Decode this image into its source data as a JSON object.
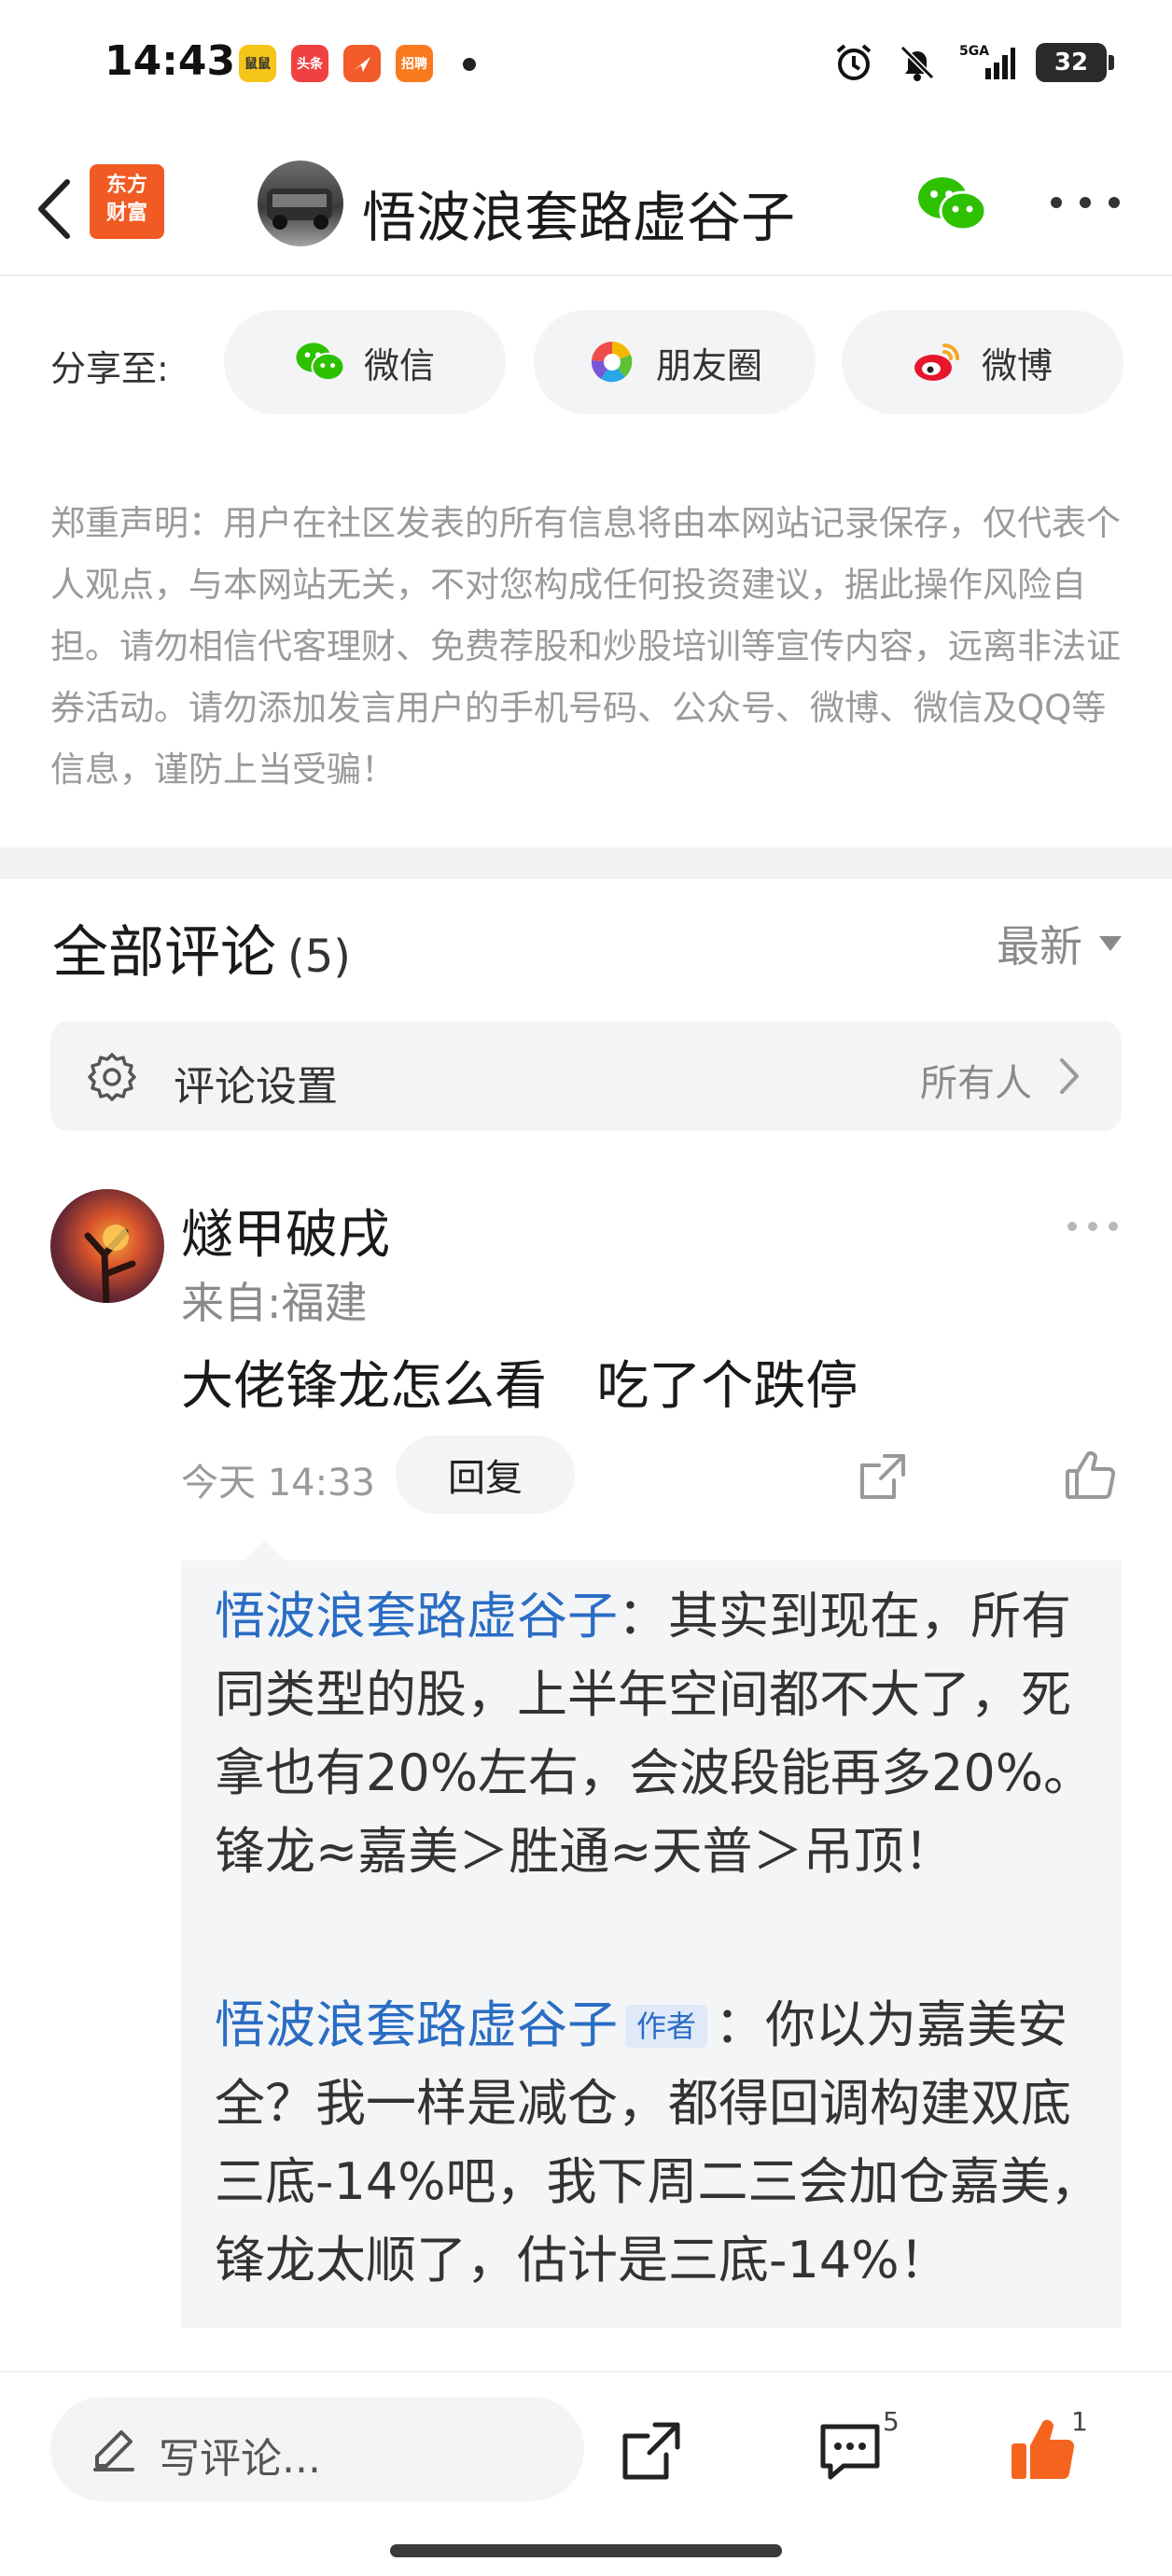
{
  "status_bar": {
    "time": "14:43",
    "notification_icons": [
      {
        "name": "app-icon-1",
        "color": "#f5c518",
        "label": "鼠鼠"
      },
      {
        "name": "toutiao-icon",
        "color": "#f04142",
        "label": "头条"
      },
      {
        "name": "app-icon-3",
        "color": "#f35b2b",
        "label": ""
      },
      {
        "name": "app-icon-4",
        "color": "#f97a1e",
        "label": "招聘"
      }
    ],
    "network": "5GA",
    "battery": "32"
  },
  "header": {
    "app_logo": "东方财富",
    "title": "悟波浪套路虚谷子"
  },
  "share": {
    "label": "分享至:",
    "buttons": [
      {
        "label": "微信",
        "icon": "wechat-icon"
      },
      {
        "label": "朋友圈",
        "icon": "moments-icon"
      },
      {
        "label": "微博",
        "icon": "weibo-icon"
      }
    ]
  },
  "disclaimer": "郑重声明：用户在社区发表的所有信息将由本网站记录保存，仅代表个人观点，与本网站无关，不对您构成任何投资建议，据此操作风险自担。请勿相信代客理财、免费荐股和炒股培训等宣传内容，远离非法证券活动。请勿添加发言用户的手机号码、公众号、微博、微信及QQ等信息，谨防上当受骗！",
  "comments": {
    "title": "全部评论",
    "count": "(5)",
    "sort": "最新",
    "settings_label": "评论设置",
    "settings_value": "所有人"
  },
  "comment": {
    "author": "燧甲破戌",
    "location": "来自:福建",
    "body": "大佬锋龙怎么看   吃了个跌停",
    "time": "今天 14:33",
    "reply_label": "回复",
    "replies": [
      {
        "author": "悟波浪套路虚谷子",
        "tag": "",
        "text": "：其实到现在，所有同类型的股，上半年空间都不大了，死拿也有20%左右，会波段能再多20%。锋龙≈嘉美＞胜通≈天普＞吊顶！"
      },
      {
        "author": "悟波浪套路虚谷子",
        "tag": "作者",
        "text": "：你以为嘉美安全？我一样是减仓，都得回调构建双底三底-14%吧，我下周二三会加仓嘉美，锋龙太顺了，估计是三底-14%！"
      }
    ]
  },
  "bottom_bar": {
    "placeholder": "写评论...",
    "comment_count": "5",
    "like_count": "1"
  },
  "colors": {
    "accent_orange": "#f15a22",
    "link_blue": "#2a6dc4",
    "like_orange": "#f5641e"
  }
}
